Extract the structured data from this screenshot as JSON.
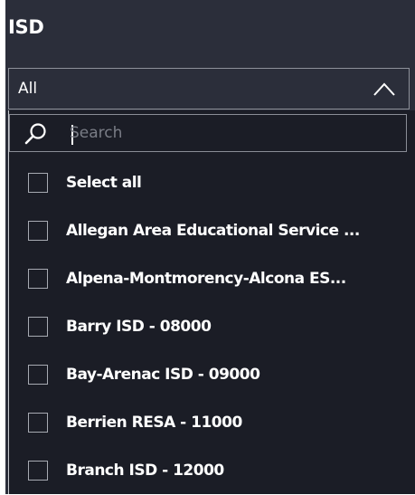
{
  "header": {
    "title": "ISD"
  },
  "select": {
    "value": "All",
    "expanded": true,
    "chevron_icon": "chevron-up-icon"
  },
  "search": {
    "placeholder": "Search",
    "value": "",
    "icon": "search-icon"
  },
  "items": [
    {
      "label": "Select all",
      "checked": false
    },
    {
      "label": "Allegan Area Educational Service ...",
      "checked": false
    },
    {
      "label": "Alpena-Montmorency-Alcona ES...",
      "checked": false
    },
    {
      "label": "Barry ISD - 08000",
      "checked": false
    },
    {
      "label": "Bay-Arenac ISD - 09000",
      "checked": false
    },
    {
      "label": "Berrien RESA - 11000",
      "checked": false
    },
    {
      "label": "Branch ISD - 12000",
      "checked": false
    }
  ],
  "colors": {
    "panel_bg": "#2b2e3a",
    "dropdown_bg": "#1b1d26",
    "text": "#ffffff",
    "border": "#8e919a"
  }
}
